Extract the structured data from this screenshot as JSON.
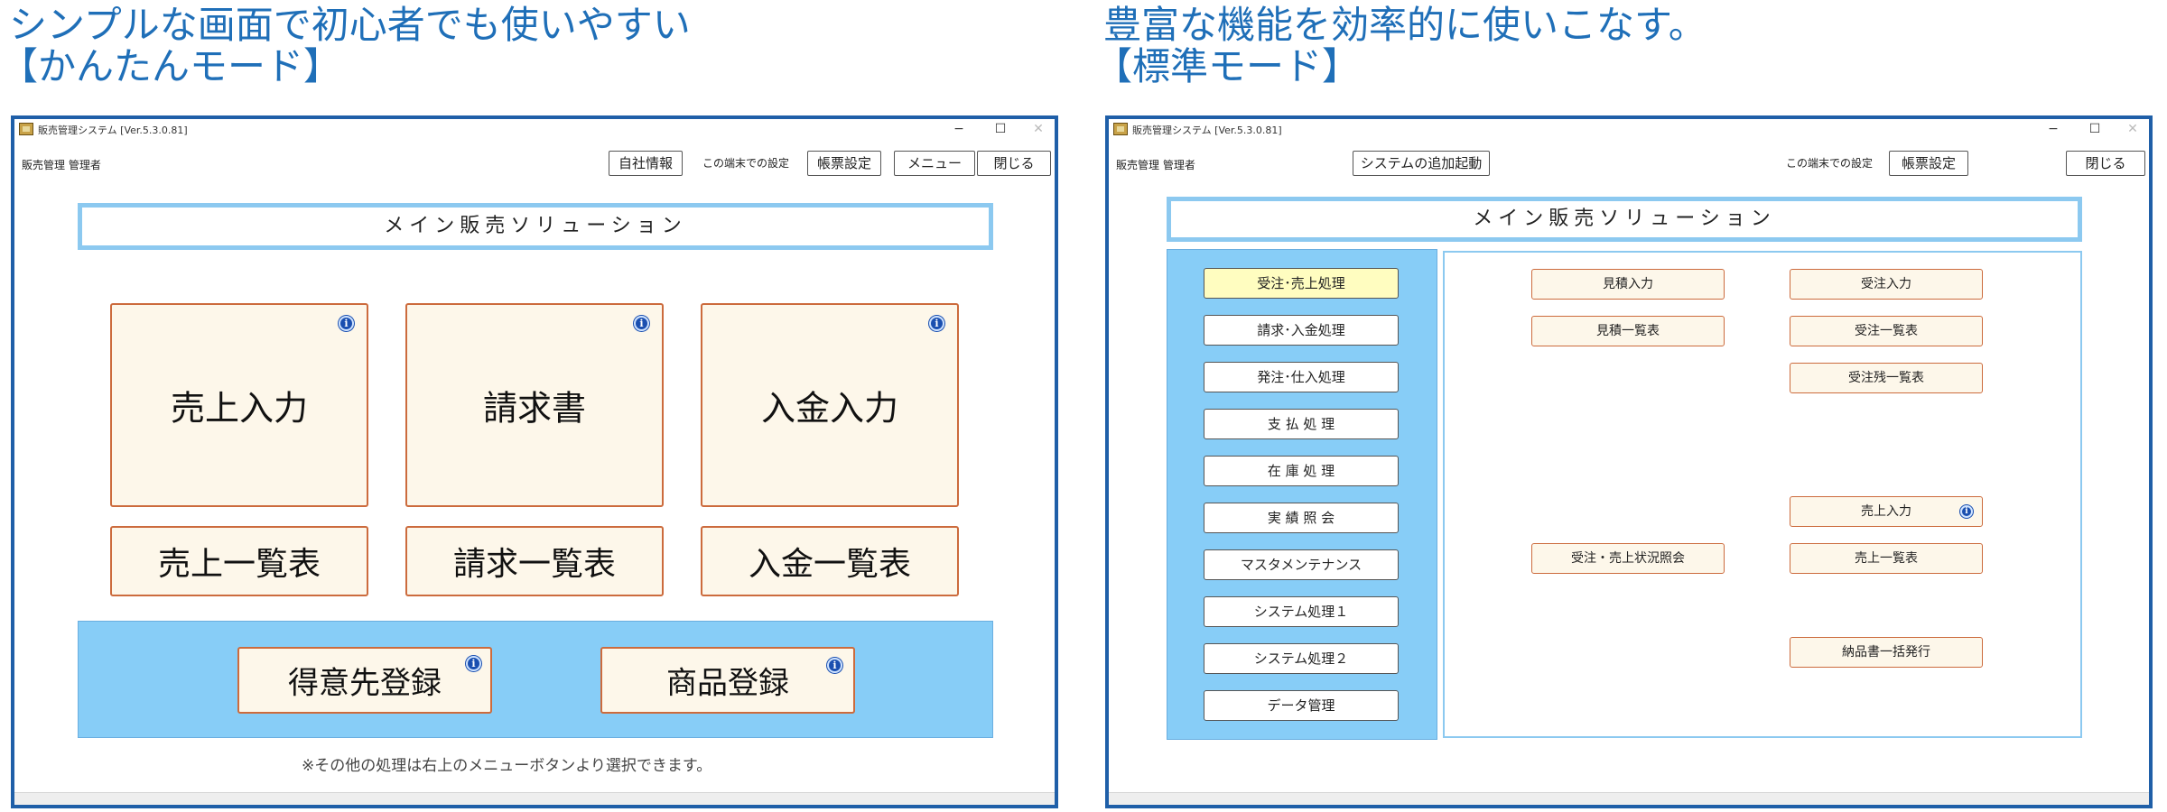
{
  "captions": {
    "left_line1": "シンプルな画面で初心者でも使いやすい",
    "left_line2": "【かんたんモード】",
    "right_line1": "豊富な機能を効率的に使いこなす。",
    "right_line2": "【標準モード】"
  },
  "window_common": {
    "title": "販売管理システム [Ver.5.3.0.81]",
    "minimize": "−",
    "maximize": "☐",
    "close": "✕",
    "user": "販売管理 管理者",
    "banner": "メイン販売ソリューション"
  },
  "easy": {
    "toolbar": {
      "company_info": "自社情報",
      "terminal_label": "この端末での設定",
      "form_settings": "帳票設定",
      "menu": "メニュー",
      "close": "閉じる"
    },
    "tiles": [
      {
        "label": "売上入力"
      },
      {
        "label": "請求書"
      },
      {
        "label": "入金入力"
      }
    ],
    "list_tiles": [
      {
        "label": "売上一覧表"
      },
      {
        "label": "請求一覧表"
      },
      {
        "label": "入金一覧表"
      }
    ],
    "register": [
      {
        "label": "得意先登録"
      },
      {
        "label": "商品登録"
      }
    ],
    "note": "※その他の処理は右上のメニューボタンより選択できます。",
    "info_glyph": "i"
  },
  "standard": {
    "toolbar": {
      "add_system": "システムの追加起動",
      "terminal_label": "この端末での設定",
      "form_settings": "帳票設定",
      "close": "閉じる"
    },
    "menu": [
      {
        "label": "受注･売上処理",
        "active": true
      },
      {
        "label": "請求･入金処理"
      },
      {
        "label": "発注･仕入処理"
      },
      {
        "label": "支 払 処 理"
      },
      {
        "label": "在 庫 処 理"
      },
      {
        "label": "実 績 照 会"
      },
      {
        "label": "マスタメンテナンス"
      },
      {
        "label": "システム処理１"
      },
      {
        "label": "システム処理２"
      },
      {
        "label": "データ管理"
      }
    ],
    "functions": {
      "estimate_input": "見積入力",
      "estimate_list": "見積一覧表",
      "order_input": "受注入力",
      "order_list": "受注一覧表",
      "order_backlog": "受注残一覧表",
      "sales_input": "売上入力",
      "order_sales_status": "受注・売上状況照会",
      "sales_list": "売上一覧表",
      "delivery_batch": "納品書一括発行"
    }
  }
}
